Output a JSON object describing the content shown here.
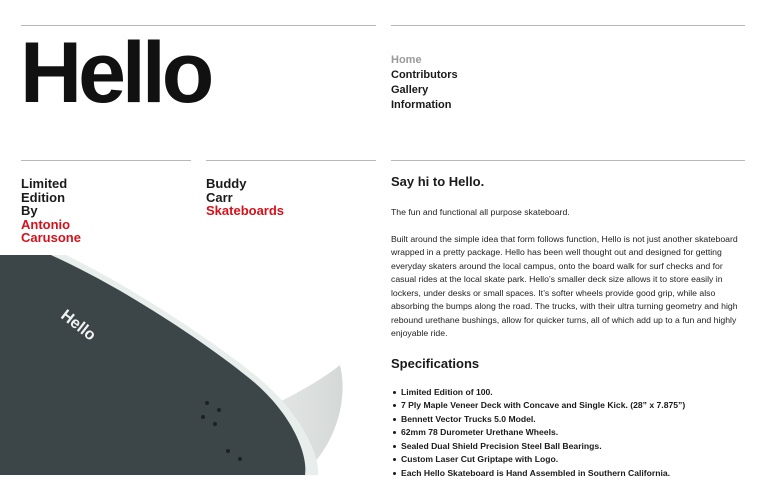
{
  "logo": {
    "text": "Hello"
  },
  "nav": {
    "items": [
      {
        "label": "Home",
        "active": true
      },
      {
        "label": "Contributors",
        "active": false
      },
      {
        "label": "Gallery",
        "active": false
      },
      {
        "label": "Information",
        "active": false
      }
    ]
  },
  "credits": {
    "left": {
      "lines": [
        "Limited",
        "Edition",
        "By"
      ],
      "highlight": [
        "Antonio",
        "Carusone"
      ]
    },
    "right": {
      "lines": [
        "Buddy",
        "Carr"
      ],
      "highlight": [
        "Skateboards"
      ]
    }
  },
  "product_image": {
    "deck_text": "Hello"
  },
  "content": {
    "heading": "Say hi to Hello.",
    "intro": "The fun and functional all purpose skateboard.",
    "body": "Built around the simple idea that form follows function, Hello is not just another skateboard wrapped in a pretty package. Hello has been well thought out and designed for getting everyday skaters around the local campus, onto the board walk for surf checks and for casual rides at the local skate park. Hello’s smaller deck size allows it to store easily in lockers, under desks or small spaces. It’s softer wheels provide good grip, while also absorbing the bumps along the road. The trucks, with their ultra turning geometry and high rebound urethane bushings, allow for quicker turns, all of which add up to a fun and highly enjoyable ride.",
    "spec_heading": "Specifications",
    "specs": [
      "Limited Edition of 100.",
      "7 Ply Maple Veneer Deck with Concave and Single Kick. (28” x 7.875”)",
      "Bennett Vector Trucks 5.0 Model.",
      "62mm 78 Durometer Urethane Wheels.",
      "Sealed Dual Shield Precision Steel Ball Bearings.",
      "Custom Laser Cut Griptape with Logo.",
      "Each Hello Skateboard is Hand Assembled in Southern California."
    ]
  },
  "colors": {
    "accent_red": "#d6111b",
    "nav_active": "#9a9a9a",
    "text": "#1a1a1a",
    "rule": "#b8b8b8",
    "deck_grip": "#3c4548",
    "deck_edge": "#e8eeec"
  }
}
